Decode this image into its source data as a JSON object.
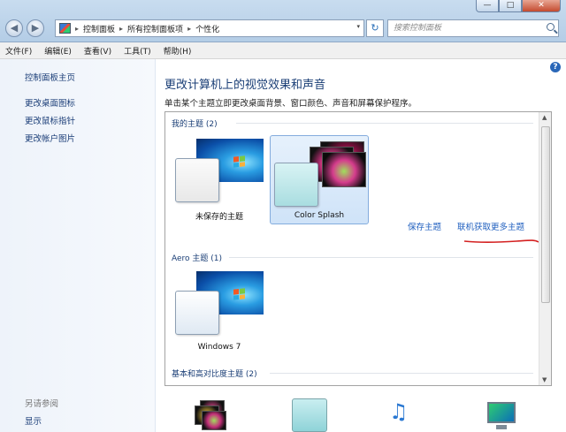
{
  "window": {
    "minimize": "—",
    "maximize": "□",
    "close": "✕"
  },
  "nav": {
    "back": "◀",
    "forward": "▶"
  },
  "address": {
    "crumbs": [
      "控制面板",
      "所有控制面板项",
      "个性化"
    ],
    "separator": "▸",
    "dropdown": "▾"
  },
  "refresh_glyph": "↻",
  "search": {
    "placeholder": "搜索控制面板"
  },
  "menu": [
    "文件(F)",
    "编辑(E)",
    "查看(V)",
    "工具(T)",
    "帮助(H)"
  ],
  "sidebar": {
    "home": "控制面板主页",
    "links": [
      "更改桌面图标",
      "更改鼠标指针",
      "更改帐户图片"
    ],
    "see_also": "另请参阅",
    "display": "显示"
  },
  "main": {
    "help": "?",
    "heading": "更改计算机上的视觉效果和声音",
    "subheading": "单击某个主题立即更改桌面背景、窗口颜色、声音和屏幕保护程序。"
  },
  "groups": {
    "my_themes": "我的主题 (2)",
    "aero": "Aero 主题 (1)",
    "basic": "基本和高对比度主题 (2)"
  },
  "themes": {
    "unsaved": "未保存的主题",
    "color_splash": "Color Splash",
    "win7": "Windows 7"
  },
  "links": {
    "save_theme": "保存主题",
    "get_more": "联机获取更多主题"
  },
  "colors": {
    "link": "#1f5fbf",
    "heading": "#1a3e76",
    "annotation": "#d42020"
  }
}
